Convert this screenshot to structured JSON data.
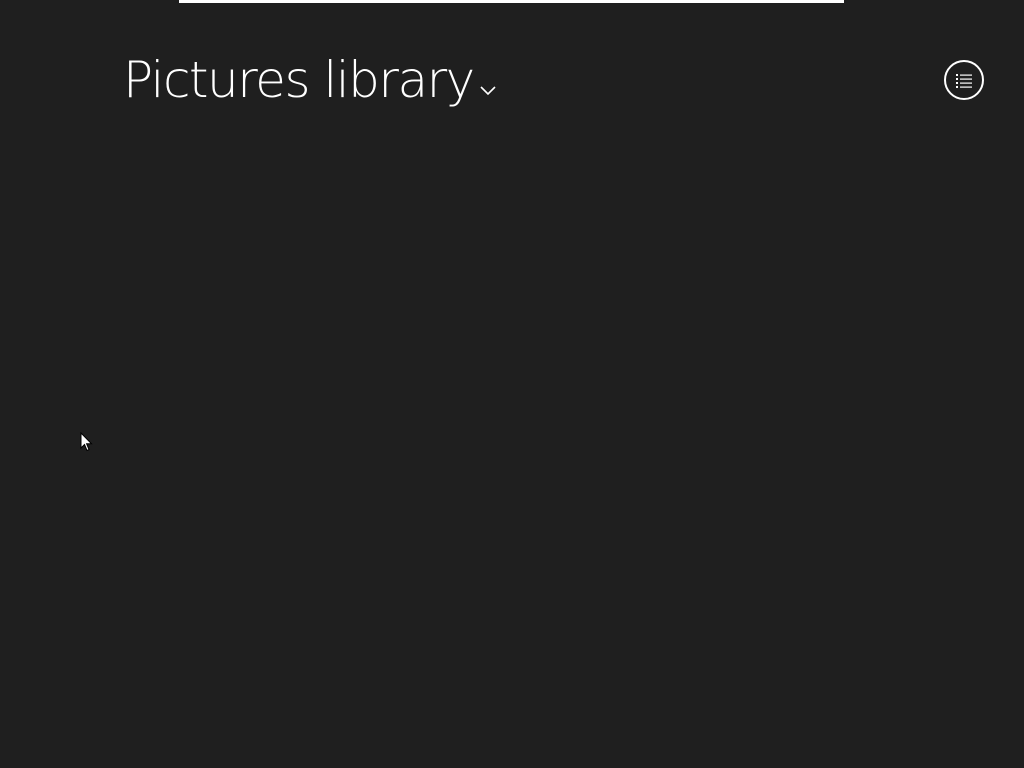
{
  "header": {
    "title": "Pictures library",
    "title_menu_icon": "chevron-down-icon",
    "view_button_icon": "list-view-icon"
  },
  "colors": {
    "background": "#1f1f1f",
    "foreground": "#ffffff"
  }
}
